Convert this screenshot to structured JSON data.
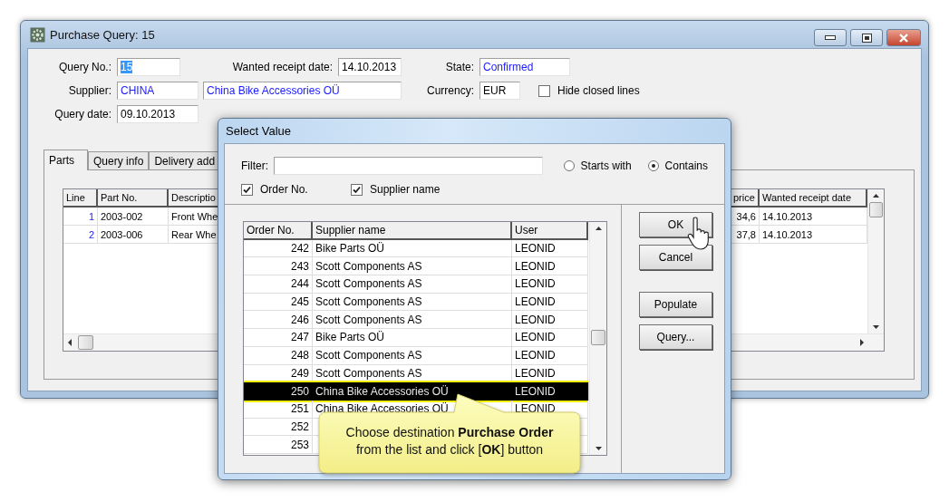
{
  "window": {
    "title": "Purchase Query: 15"
  },
  "form": {
    "query_no": {
      "label": "Query No.:",
      "value": "15",
      "text_selected": true
    },
    "wanted_receipt_date": {
      "label": "Wanted receipt date:",
      "value": "14.10.2013",
      "linked": false
    },
    "state": {
      "label": "State:",
      "value": "Confirmed",
      "linked": true
    },
    "supplier": {
      "label": "Supplier:",
      "code": "CHINA",
      "name": "China Bike Accessories OÜ",
      "linked": true
    },
    "currency": {
      "label": "Currency:",
      "value": "EUR",
      "linked": false
    },
    "hide_closed_lines": {
      "label": "Hide closed lines",
      "checked": false
    },
    "query_date": {
      "label": "Query date:",
      "value": "09.10.2013",
      "linked": false
    }
  },
  "tabs": [
    {
      "label": "Parts",
      "selected": true
    },
    {
      "label": "Query info",
      "selected": false
    },
    {
      "label": "Delivery add",
      "selected": false
    }
  ],
  "parts_table": {
    "columns": [
      "Line",
      "Part No.",
      "Descriptio",
      "price",
      "Wanted receipt date"
    ],
    "rows": [
      {
        "line": "1",
        "part_no": "2003-002",
        "description": "Front Whe",
        "price": "34,6",
        "wanted_receipt_date": "14.10.2013"
      },
      {
        "line": "2",
        "part_no": "2003-006",
        "description": "Rear Whe",
        "price": "37,8",
        "wanted_receipt_date": "14.10.2013"
      }
    ]
  },
  "dialog": {
    "title": "Select Value",
    "filter": {
      "label": "Filter:"
    },
    "match_modes": [
      {
        "label": "Starts with",
        "selected": false
      },
      {
        "label": "Contains",
        "selected": true
      }
    ],
    "search_fields": [
      {
        "label": "Order No.",
        "checked": true
      },
      {
        "label": "Supplier name",
        "checked": true
      }
    ],
    "list": {
      "columns": [
        "Order No.",
        "Supplier name",
        "User"
      ],
      "rows": [
        {
          "order_no": "242",
          "supplier": "Bike Parts OÜ",
          "user": "LEONID",
          "selected": false
        },
        {
          "order_no": "243",
          "supplier": "Scott Components AS",
          "user": "LEONID",
          "selected": false
        },
        {
          "order_no": "244",
          "supplier": "Scott Components AS",
          "user": "LEONID",
          "selected": false
        },
        {
          "order_no": "245",
          "supplier": "Scott Components AS",
          "user": "LEONID",
          "selected": false
        },
        {
          "order_no": "246",
          "supplier": "Scott Components AS",
          "user": "LEONID",
          "selected": false
        },
        {
          "order_no": "247",
          "supplier": "Bike Parts OÜ",
          "user": "LEONID",
          "selected": false
        },
        {
          "order_no": "248",
          "supplier": "Scott Components AS",
          "user": "LEONID",
          "selected": false
        },
        {
          "order_no": "249",
          "supplier": "Scott Components AS",
          "user": "LEONID",
          "selected": false
        },
        {
          "order_no": "250",
          "supplier": "China Bike Accessories OÜ",
          "user": "LEONID",
          "selected": true
        },
        {
          "order_no": "251",
          "supplier": "China Bike Accessories OÜ",
          "user": "LEONID",
          "selected": false
        },
        {
          "order_no": "252",
          "selected": false
        },
        {
          "order_no": "253",
          "selected": false
        }
      ]
    },
    "buttons": [
      "OK",
      "Cancel",
      "Populate",
      "Query..."
    ]
  },
  "callout": {
    "text": "Choose destination **Purchase Order** from the list and click [**OK**] button"
  }
}
